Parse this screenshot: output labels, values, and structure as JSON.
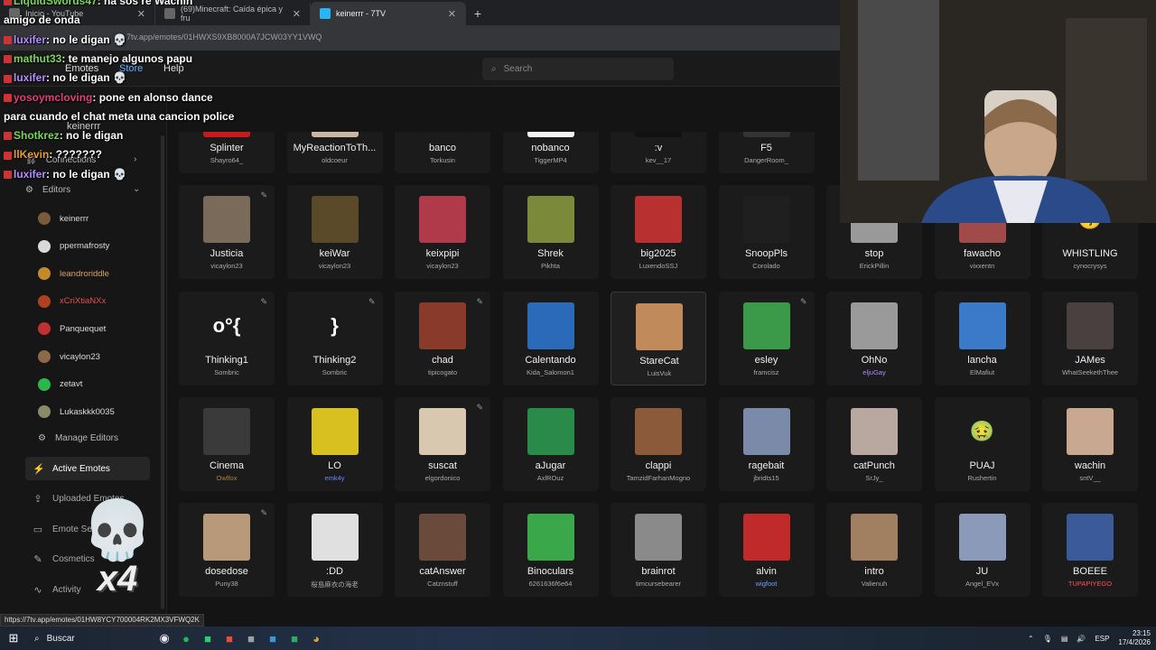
{
  "browser": {
    "tabs": [
      {
        "label": "Inicio - YouTube"
      },
      {
        "label": "(69)Minecraft: Caída épica y fru"
      },
      {
        "label": "keinerrr - 7TV",
        "active": true
      }
    ],
    "new_tab": "+",
    "url": "7tv.app/emotes/01HWXS9XB8000A7JCW03YY1VWQ"
  },
  "header": {
    "nav": [
      "Emotes",
      "Store",
      "Help"
    ],
    "search_placeholder": "Search"
  },
  "sidebar": {
    "channel_title": "keinerrr",
    "connections_label": "Connections",
    "editors_label": "Editors",
    "editors": [
      {
        "name": "keinerrr",
        "color": "#dcdcdc",
        "avatar": "#7a5a3a"
      },
      {
        "name": "ppermafrosty",
        "color": "#dcdcdc",
        "avatar": "#d9d9d9"
      },
      {
        "name": "leandroriddle",
        "color": "#d9a35a",
        "avatar": "#c38a2c"
      },
      {
        "name": "xCriXtiaNXx",
        "color": "#e05050",
        "avatar": "#b04020"
      },
      {
        "name": "Panquequet",
        "color": "#dcdcdc",
        "avatar": "#c03030"
      },
      {
        "name": "vicaylon23",
        "color": "#dcdcdc",
        "avatar": "#8a6a4a"
      },
      {
        "name": "zetavt",
        "color": "#dcdcdc",
        "avatar": "#2bb84a"
      },
      {
        "name": "Lukaskkk0035",
        "color": "#dcdcdc",
        "avatar": "#8a8a6a"
      }
    ],
    "manage_editors": "Manage Editors",
    "menu": [
      {
        "label": "Active Emotes",
        "icon": "bolt-icon",
        "active": true
      },
      {
        "label": "Uploaded Emotes",
        "icon": "upload-icon",
        "active": false
      },
      {
        "label": "Emote Sets",
        "icon": "folder-icon",
        "active": false
      },
      {
        "label": "Cosmetics",
        "icon": "brush-icon",
        "active": false
      },
      {
        "label": "Activity",
        "icon": "activity-icon",
        "active": false
      }
    ]
  },
  "emotes": [
    {
      "name": "Splinter",
      "owner": "Shayro64_",
      "bg": "#c41c1c",
      "glyph": ""
    },
    {
      "name": "MyReactionToTh...",
      "owner": "oldcoeur",
      "bg": "#c9b6a6",
      "glyph": ""
    },
    {
      "name": "banco",
      "owner": "Torkusin",
      "bg": "#1b1b1b",
      "glyph": ""
    },
    {
      "name": "nobanco",
      "owner": "TiggerMP4",
      "bg": "#f2f2f2",
      "glyph": ""
    },
    {
      "name": ":v",
      "owner": "kev__17",
      "bg": "#111111",
      "glyph": "▶"
    },
    {
      "name": "F5",
      "owner": "DangerRoom_",
      "bg": "#333333",
      "glyph": "F5"
    },
    {
      "name": "Justicia",
      "owner": "vicaylon23",
      "bg": "#7a6a5a",
      "glyph": "",
      "editable": true
    },
    {
      "name": "keiWar",
      "owner": "vicaylon23",
      "bg": "#5a4a2a",
      "glyph": ""
    },
    {
      "name": "keixpipi",
      "owner": "vicaylon23",
      "bg": "#b03a4a",
      "glyph": ""
    },
    {
      "name": "Shrek",
      "owner": "Pikhta",
      "bg": "#7a8a3a",
      "glyph": ""
    },
    {
      "name": "big2025",
      "owner": "LuxendoSSJ",
      "bg": "#b83030",
      "glyph": ""
    },
    {
      "name": "SnoopPls",
      "owner": "Corolado",
      "bg": "#1f1f1f",
      "glyph": ""
    },
    {
      "name": "stop",
      "owner": "ErickPillin",
      "bg": "#9a9a9a",
      "glyph": ""
    },
    {
      "name": "fawacho",
      "owner": "vixxentn",
      "bg": "#a04a4a",
      "glyph": ""
    },
    {
      "name": "WHISTLING",
      "owner": "cynocrysys",
      "bg": "#1b1b1b",
      "glyph": "😗"
    },
    {
      "name": "Thinking1",
      "owner": "Sombric",
      "bg": "#1b1b1b",
      "glyph": "o°{",
      "editable": true
    },
    {
      "name": "Thinking2",
      "owner": "Sombric",
      "bg": "#1b1b1b",
      "glyph": "}",
      "editable": true
    },
    {
      "name": "chad",
      "owner": "tipicogato",
      "bg": "#8a3a2a",
      "glyph": "",
      "editable": true
    },
    {
      "name": "Calentando",
      "owner": "Kida_Salomon1",
      "bg": "#2a6ab8",
      "glyph": ""
    },
    {
      "name": "StareCat",
      "owner": "LuisVuk",
      "bg": "#c08a5a",
      "glyph": ""
    },
    {
      "name": "esley",
      "owner": "framcisz",
      "bg": "#3a9a4a",
      "glyph": "",
      "editable": true
    },
    {
      "name": "OhNo",
      "owner": "eljuGay",
      "bg": "#9a9a9a",
      "glyph": ""
    },
    {
      "name": "lancha",
      "owner": "ElMafiut",
      "bg": "#3a7ac8",
      "glyph": ""
    },
    {
      "name": "JAMes",
      "owner": "WhatSeekethThee",
      "bg": "#4a4040",
      "glyph": ""
    },
    {
      "name": "Cinema",
      "owner": "Owlfox",
      "bg": "#3a3a3a",
      "glyph": ""
    },
    {
      "name": "LO",
      "owner": "emk4y",
      "bg": "#d8c020",
      "glyph": ""
    },
    {
      "name": "suscat",
      "owner": "elgordonico",
      "bg": "#d8c8b0",
      "glyph": "",
      "editable": true
    },
    {
      "name": "aJugar",
      "owner": "AxlROuz",
      "bg": "#2a8a4a",
      "glyph": ""
    },
    {
      "name": "clappi",
      "owner": "TamzidFarhanMogno",
      "bg": "#8a5a3a",
      "glyph": ""
    },
    {
      "name": "ragebait",
      "owner": "jbridts15",
      "bg": "#7a8aa8",
      "glyph": ""
    },
    {
      "name": "catPunch",
      "owner": "SrJy_",
      "bg": "#b8a8a0",
      "glyph": ""
    },
    {
      "name": "PUAJ",
      "owner": "Rushertin",
      "bg": "#1b1b1b",
      "glyph": "🤢"
    },
    {
      "name": "wachin",
      "owner": "sntV__",
      "bg": "#c8a890",
      "glyph": ""
    },
    {
      "name": "dosedose",
      "owner": "Puny38",
      "bg": "#b89a7a",
      "glyph": "",
      "editable": true
    },
    {
      "name": ":DD",
      "owner": "桜島麻衣の海老",
      "bg": "#e0e0e0",
      "glyph": ""
    },
    {
      "name": "catAnswer",
      "owner": "Catznstuff",
      "bg": "#6a4a3a",
      "glyph": ""
    },
    {
      "name": "Binoculars",
      "owner": "6261636f6e64",
      "bg": "#3aa84a",
      "glyph": ""
    },
    {
      "name": "brainrot",
      "owner": "timcursebearer",
      "bg": "#8a8a8a",
      "glyph": ""
    },
    {
      "name": "alvin",
      "owner": "wigfoot",
      "bg": "#c02a2a",
      "glyph": ""
    },
    {
      "name": "intro",
      "owner": "Valienuh",
      "bg": "#a08060",
      "glyph": ""
    },
    {
      "name": "JU",
      "owner": "Angel_EVx",
      "bg": "#8a9ab8",
      "glyph": ""
    },
    {
      "name": "BOEEE",
      "owner": "TUPAPIYEGO",
      "bg": "#3a5a9a",
      "glyph": ""
    }
  ],
  "owner_colors": {
    "Owlfox": "#b08040",
    "emk4y": "#6a8aff",
    "eljuGay": "#b08aff",
    "wigfoot": "#6aa0ff",
    "TUPAPIYEGO": "#ff5050"
  },
  "chat": [
    {
      "user": "LiquidSwords47",
      "color": "#7ad65a",
      "msg": ": ha sos re Wachin"
    },
    {
      "user": "",
      "color": "#fff",
      "msg": "amigo de onda"
    },
    {
      "user": "luxifer",
      "color": "#b58aff",
      "msg": ": no le digan 💀"
    },
    {
      "user": "mathut33",
      "color": "#7ad65a",
      "msg": ": te manejo algunos papu"
    },
    {
      "user": "luxifer",
      "color": "#b58aff",
      "msg": ": no le digan 💀"
    },
    {
      "user": "yosoymcloving",
      "color": "#e0407a",
      "msg": ": pone en alonso dance"
    },
    {
      "user": "",
      "color": "#fff",
      "msg": "para cuando el chat meta una cancion police"
    },
    {
      "user": "Shotkrez",
      "color": "#7ad65a",
      "msg": ": no le digan"
    },
    {
      "user": "llKevin",
      "color": "#e0a030",
      "msg": ": ???????"
    },
    {
      "user": "luxifer",
      "color": "#b58aff",
      "msg": ": no le digan 💀"
    }
  ],
  "overlay": {
    "skull": "💀",
    "multiplier": "x4"
  },
  "status_url": "https://7tv.app/emotes/01HW8YCY700004RK2MX3VFWQ2K",
  "taskbar": {
    "search_label": "Buscar",
    "language": "ESP",
    "time": "23:15",
    "date": "17/4/2026"
  }
}
